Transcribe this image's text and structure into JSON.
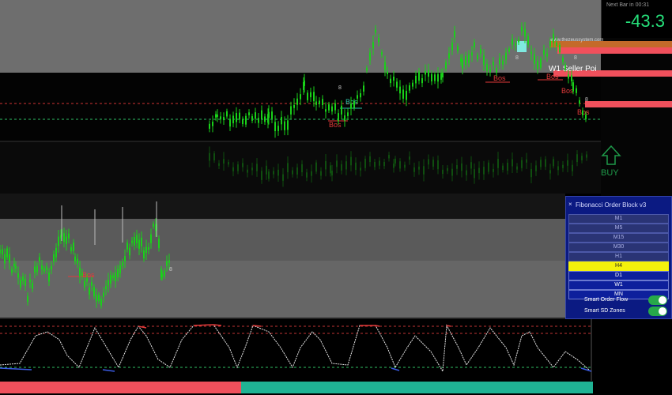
{
  "price_box": {
    "timer": "Next Bar in 00:31",
    "value": "-43.3"
  },
  "chart": {
    "brand_text": "www.thezeussystem.com",
    "zone_label": "W1 Seller Poi",
    "bos_label": "Bos",
    "level_label": "8",
    "buy_label": "BUY"
  },
  "panel": {
    "title": "Fibonacci Order Block v3",
    "close_symbol": "×",
    "timeframes": [
      {
        "label": "M1",
        "state": "dim"
      },
      {
        "label": "M5",
        "state": "dim"
      },
      {
        "label": "M15",
        "state": "dim"
      },
      {
        "label": "M30",
        "state": "dim"
      },
      {
        "label": "H1",
        "state": "dim"
      },
      {
        "label": "H4",
        "state": "active"
      },
      {
        "label": "D1",
        "state": "normal"
      },
      {
        "label": "W1",
        "state": "normal"
      },
      {
        "label": "MN",
        "state": "normal"
      }
    ],
    "toggles": [
      {
        "label": "Smart Order Flow",
        "on": true
      },
      {
        "label": "Smart SD Zones",
        "on": true
      }
    ]
  },
  "colors": {
    "candle": "#19d119",
    "bearish_zone": "#f0505c",
    "bos_red": "#e23a3a",
    "bos_teal": "#2fc6a8",
    "toggle_on": "#27a84a",
    "panel_bg": "#0b1a82",
    "highlight": "#f4f10c"
  }
}
